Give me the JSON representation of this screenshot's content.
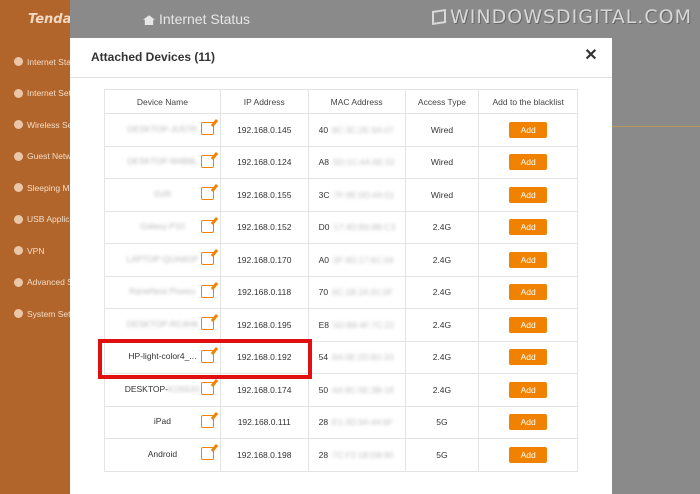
{
  "sidebar": {
    "logo": "Tenda",
    "items": [
      {
        "label": "Internet Status"
      },
      {
        "label": "Internet Settings"
      },
      {
        "label": "Wireless Settings"
      },
      {
        "label": "Guest Network"
      },
      {
        "label": "Sleeping Mode"
      },
      {
        "label": "USB Application"
      },
      {
        "label": "VPN"
      },
      {
        "label": "Advanced Settings"
      },
      {
        "label": "System Settings"
      }
    ]
  },
  "header": {
    "page_title": "Internet Status",
    "watermark": "WINDOWSDIGITAL.COM"
  },
  "modal": {
    "title": "Attached Devices (11)",
    "close_label": "✕",
    "columns": [
      "Device Name",
      "IP Address",
      "MAC Address",
      "Access Type",
      "Add to the blacklist"
    ],
    "add_label": "Add",
    "rows": [
      {
        "name": "DESKTOP-JU5TR",
        "blurred": true,
        "ip": "192.168.0.145",
        "mac_prefix": "40",
        "mac_rest": ":8C:3C:2E:9A:07",
        "access": "Wired"
      },
      {
        "name": "DESKTOP-M4B8L",
        "blurred": true,
        "ip": "192.168.0.124",
        "mac_prefix": "A8",
        "mac_rest": ":5D:1C:4A:6E:02",
        "access": "Wired"
      },
      {
        "name": "SVR",
        "blurred": true,
        "ip": "192.168.0.155",
        "mac_prefix": "3C",
        "mac_rest": ":7F:9E:0D:4A:51",
        "access": "Wired"
      },
      {
        "name": "Galaxy-P10",
        "blurred": true,
        "ip": "192.168.0.152",
        "mac_prefix": "D0",
        "mac_rest": ":17:4D:B6:8B:C3",
        "access": "2.4G"
      },
      {
        "name": "LAPTOP-QUA6GP",
        "blurred": true,
        "ip": "192.168.0.170",
        "mac_prefix": "A0",
        "mac_rest": ":3F:8D:17:6C:04",
        "access": "2.4G"
      },
      {
        "name": "RaneNest Pixeeu",
        "blurred": true,
        "ip": "192.168.0.118",
        "mac_prefix": "70",
        "mac_rest": ":6C:1B:2A:91:0F",
        "access": "2.4G"
      },
      {
        "name": "DESKTOP-RC4H6",
        "blurred": true,
        "ip": "192.168.0.195",
        "mac_prefix": "E8",
        "mac_rest": ":5D:B8:4F:7C:22",
        "access": "2.4G"
      },
      {
        "name": "HP-light-color4_...",
        "blurred": false,
        "ip": "192.168.0.192",
        "mac_prefix": "54",
        "mac_rest": ":6A:0E:2D:B1:33",
        "access": "2.4G"
      },
      {
        "name": "DESKTOP-",
        "name_blur": "K1N3JG",
        "blurred": false,
        "ip": "192.168.0.174",
        "mac_prefix": "50",
        "mac_rest": ":4A:9C:5E:3B:18",
        "access": "2.4G"
      },
      {
        "name": "iPad",
        "blurred": false,
        "ip": "192.168.0.111",
        "mac_prefix": "28",
        "mac_rest": ":E1:3D:9A:44:6F",
        "access": "5G"
      },
      {
        "name": "Android",
        "blurred": false,
        "ip": "192.168.0.198",
        "mac_prefix": "28",
        "mac_rest": ":7C:F2:1B:D8:90",
        "access": "5G"
      }
    ]
  },
  "colors": {
    "sidebar_bg": "#b2652a",
    "accent": "#f08200",
    "highlight": "#e01010",
    "overlay": "#8a8a8a"
  }
}
